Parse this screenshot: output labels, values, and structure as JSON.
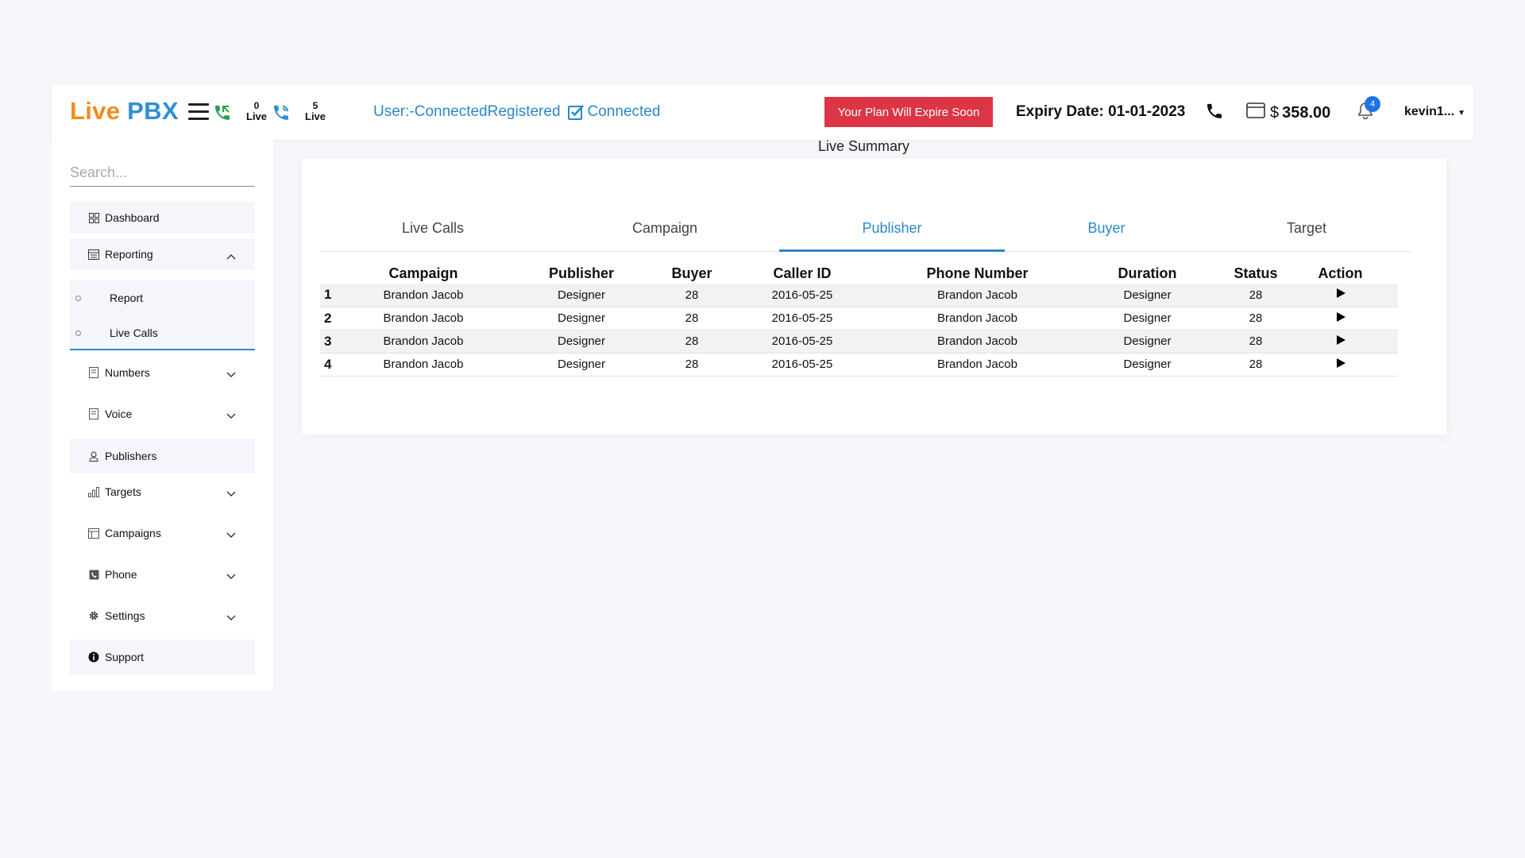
{
  "header": {
    "logo_part1": "Live",
    "logo_part2": "PBX",
    "live1_count": "0",
    "live1_label": "Live",
    "live2_count": "5",
    "live2_label": "Live",
    "user_status": "User:-ConnectedRegistered",
    "connection_status": "Connected",
    "expire_button": "Your Plan Will Expire Soon",
    "expiry_date": "Expiry Date: 01-01-2023",
    "currency": "$",
    "balance": "358.00",
    "notification_count": "4",
    "username": "kevin1...",
    "colors": {
      "orange": "#f28b1e",
      "blue": "#2f8fd6",
      "danger": "#dc3545",
      "green": "#1fa34a"
    }
  },
  "sidebar": {
    "search_placeholder": "Search...",
    "items": {
      "dashboard": "Dashboard",
      "reporting": "Reporting",
      "report": "Report",
      "live_calls": "Live Calls",
      "numbers": "Numbers",
      "voice": "Voice",
      "publishers": "Publishers",
      "targets": "Targets",
      "campaigns": "Campaigns",
      "phone": "Phone",
      "settings": "Settings",
      "support": "Support"
    }
  },
  "main": {
    "title": "Live Summary",
    "tabs": {
      "live_calls": "Live Calls",
      "campaign": "Campaign",
      "publisher": "Publisher",
      "buyer": "Buyer",
      "target": "Target"
    },
    "active_tab": "Publisher",
    "table": {
      "headers": [
        "Campaign",
        "Publisher",
        "Buyer",
        "Caller ID",
        "Phone Number",
        "Duration",
        "Status",
        "Action"
      ],
      "rows": [
        {
          "idx": "1",
          "campaign": "Brandon Jacob",
          "publisher": "Designer",
          "buyer": "28",
          "caller_id": "2016-05-25",
          "phone": "Brandon Jacob",
          "duration": "Designer",
          "status": "28"
        },
        {
          "idx": "2",
          "campaign": "Brandon Jacob",
          "publisher": "Designer",
          "buyer": "28",
          "caller_id": "2016-05-25",
          "phone": "Brandon Jacob",
          "duration": "Designer",
          "status": "28"
        },
        {
          "idx": "3",
          "campaign": "Brandon Jacob",
          "publisher": "Designer",
          "buyer": "28",
          "caller_id": "2016-05-25",
          "phone": "Brandon Jacob",
          "duration": "Designer",
          "status": "28"
        },
        {
          "idx": "4",
          "campaign": "Brandon Jacob",
          "publisher": "Designer",
          "buyer": "28",
          "caller_id": "2016-05-25",
          "phone": "Brandon Jacob",
          "duration": "Designer",
          "status": "28"
        }
      ]
    }
  }
}
